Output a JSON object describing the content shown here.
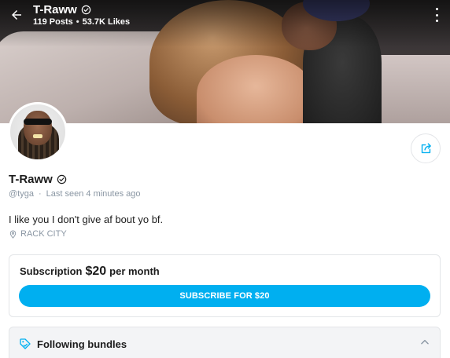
{
  "header": {
    "name": "T-Raww",
    "posts": "119 Posts",
    "likes": "53.7K Likes",
    "separator": "•"
  },
  "profile": {
    "name": "T-Raww",
    "handle": "@tyga",
    "meta_separator": "·",
    "last_seen": "Last seen 4 minutes ago",
    "bio": "I like you I don't give af bout yo bf.",
    "location": "RACK CITY"
  },
  "subscription": {
    "label": "Subscription",
    "price": "$20",
    "period": "per month",
    "button_label": "SUBSCRIBE FOR $20"
  },
  "bundles": {
    "label": "Following bundles"
  },
  "icons": {
    "back": "arrow-left-icon",
    "verified": "verified-check-icon",
    "more": "more-vertical-icon",
    "share": "share-icon",
    "location": "location-pin-icon",
    "bundle": "tag-icon",
    "collapse": "chevron-up-icon"
  },
  "colors": {
    "accent": "#00aff0",
    "muted_text": "#8a96a3",
    "primary_text": "#1c1c1c",
    "border": "#e3e5e8"
  }
}
